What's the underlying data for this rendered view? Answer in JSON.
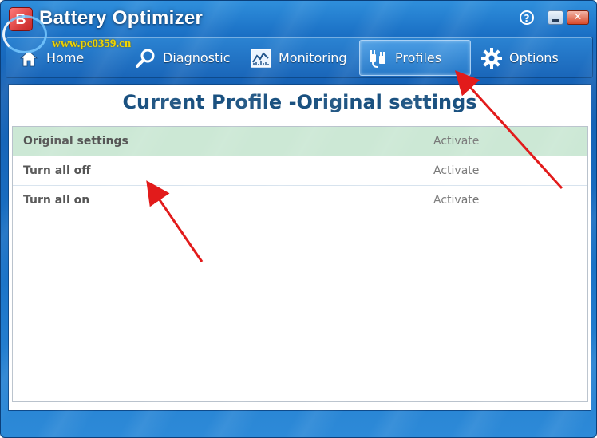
{
  "window": {
    "title": "Battery Optimizer",
    "logo_letter": "B",
    "help_label": "?",
    "close_label": "✕",
    "watermark": "www.pc0359.cn"
  },
  "nav": {
    "items": [
      {
        "label": "Home",
        "icon": "home-icon"
      },
      {
        "label": "Diagnostic",
        "icon": "magnifier-icon"
      },
      {
        "label": "Monitoring",
        "icon": "chart-icon"
      },
      {
        "label": "Profiles",
        "icon": "plug-icon",
        "active": true
      },
      {
        "label": "Options",
        "icon": "gear-icon"
      }
    ]
  },
  "main": {
    "title": "Current Profile -Original settings",
    "profiles": [
      {
        "name": "Original settings",
        "action": "Activate",
        "selected": true
      },
      {
        "name": "Turn all off",
        "action": "Activate",
        "selected": false
      },
      {
        "name": "Turn all on",
        "action": "Activate",
        "selected": false
      }
    ]
  },
  "colors": {
    "accent": "#1a6fc4",
    "selected_row": "#cce8d5",
    "title_text": "#1a5180",
    "annotation_arrow": "#e21b1b"
  }
}
